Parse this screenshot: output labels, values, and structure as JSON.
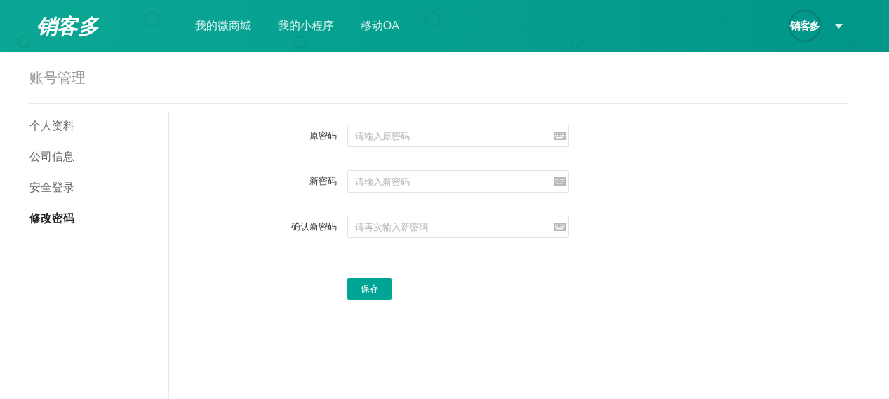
{
  "header": {
    "logo": "销客多",
    "nav": [
      {
        "label": "我的微商城"
      },
      {
        "label": "我的小程序"
      },
      {
        "label": "移动OA"
      }
    ],
    "avatar_text": "销客多"
  },
  "page_title": "账号管理",
  "sidebar": {
    "items": [
      {
        "label": "个人资料",
        "selected": false
      },
      {
        "label": "公司信息",
        "selected": false
      },
      {
        "label": "安全登录",
        "selected": false
      },
      {
        "label": "修改密码",
        "selected": true
      }
    ]
  },
  "form": {
    "fields": [
      {
        "label": "原密码",
        "placeholder": "请输入原密码"
      },
      {
        "label": "新密码",
        "placeholder": "请输入新密码"
      },
      {
        "label": "确认新密码",
        "placeholder": "请再次输入新密码"
      }
    ],
    "submit": "保存"
  }
}
